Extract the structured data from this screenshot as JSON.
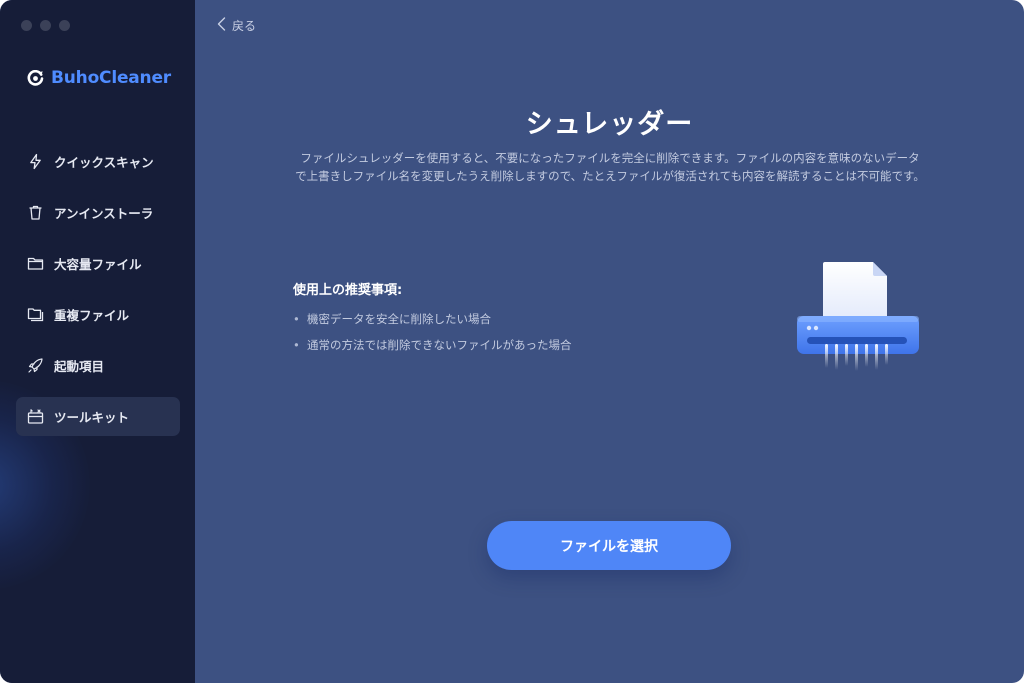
{
  "app": {
    "name": "BuhoCleaner",
    "accent": "#4f8cff"
  },
  "sidebar": {
    "items": [
      {
        "label": "クイックスキャン",
        "icon": "lightning-icon",
        "active": false
      },
      {
        "label": "アンインストーラ",
        "icon": "trash-icon",
        "active": false
      },
      {
        "label": "大容量ファイル",
        "icon": "folder-icon",
        "active": false
      },
      {
        "label": "重複ファイル",
        "icon": "duplicate-folder-icon",
        "active": false
      },
      {
        "label": "起動項目",
        "icon": "rocket-icon",
        "active": false
      },
      {
        "label": "ツールキット",
        "icon": "toolkit-icon",
        "active": true
      }
    ]
  },
  "header": {
    "back_label": "戻る"
  },
  "main": {
    "title": "シュレッダー",
    "description": "ファイルシュレッダーを使用すると、不要になったファイルを完全に削除できます。ファイルの内容を意味のないデータで上書きしファイル名を変更したうえ削除しますので、たとえファイルが復活されても内容を解読することは不可能です。",
    "recommend_title": "使用上の推奨事項:",
    "recommend_items": [
      "機密データを安全に削除したい場合",
      "通常の方法では削除できないファイルがあった場合"
    ],
    "select_button": "ファイルを選択"
  }
}
